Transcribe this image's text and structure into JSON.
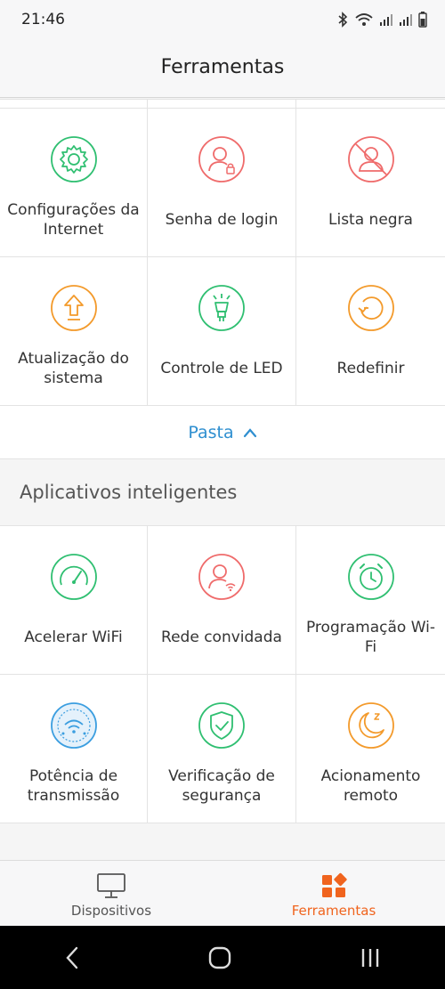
{
  "status_bar": {
    "time": "21:46"
  },
  "header": {
    "title": "Ferramentas"
  },
  "tools": [
    {
      "label": "Configurações da Internet",
      "icon": "gear-icon",
      "color": "#2fbf71"
    },
    {
      "label": "Senha de login",
      "icon": "user-lock-icon",
      "color": "#ef6b6b"
    },
    {
      "label": "Lista negra",
      "icon": "user-blocked-icon",
      "color": "#ef6b6b"
    },
    {
      "label": "Atualização do sistema",
      "icon": "upgrade-arrow-icon",
      "color": "#f39a2b"
    },
    {
      "label": "Controle de LED",
      "icon": "led-bulb-icon",
      "color": "#2fbf71"
    },
    {
      "label": "Redefinir",
      "icon": "reset-icon",
      "color": "#f39a2b"
    }
  ],
  "fold": {
    "label": "Pasta"
  },
  "smart_apps": {
    "title": "Aplicativos inteligentes",
    "items": [
      {
        "label": "Acelerar WiFi",
        "icon": "speedometer-icon",
        "color": "#2fbf71"
      },
      {
        "label": "Rede convidada",
        "icon": "guest-network-icon",
        "color": "#ef6b6b"
      },
      {
        "label": "Programação Wi-Fi",
        "icon": "alarm-clock-icon",
        "color": "#2fbf71"
      },
      {
        "label": "Potência de transmissão",
        "icon": "wifi-power-icon",
        "color": "#3b9ee0"
      },
      {
        "label": "Verificação de segurança",
        "icon": "shield-check-icon",
        "color": "#2fbf71"
      },
      {
        "label": "Acionamento remoto",
        "icon": "moon-sleep-icon",
        "color": "#f39a2b"
      }
    ]
  },
  "bottom_nav": {
    "devices": "Dispositivos",
    "tools": "Ferramentas",
    "active": "tools",
    "active_color": "#f0641e"
  }
}
